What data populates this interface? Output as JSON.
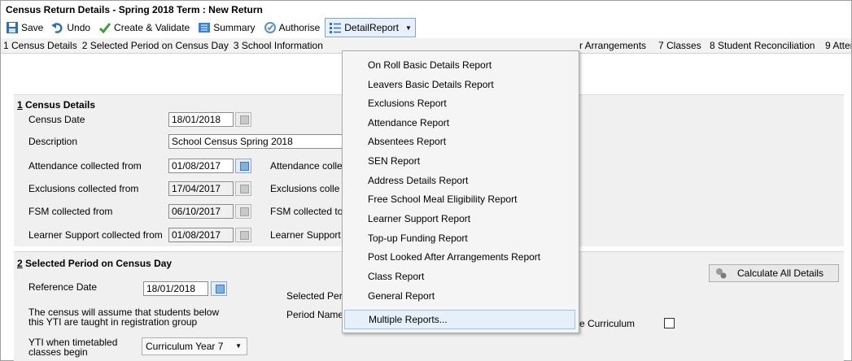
{
  "window": {
    "title": "Census Return Details - Spring 2018 Term : New Return"
  },
  "toolbar": {
    "save": "Save",
    "undo": "Undo",
    "create_validate": "Create & Validate",
    "summary": "Summary",
    "authorise": "Authorise",
    "detail_report": "DetailReport"
  },
  "tabs": {
    "t1": "1 Census Details",
    "t2": "2 Selected Period on Census Day",
    "t3": "3 School Information",
    "t_arr": "r Arrangements",
    "t7": "7 Classes",
    "t8": "8 Student Reconciliation",
    "t9": "9 Atter"
  },
  "section1": {
    "heading_num": "1",
    "heading_text": " Census Details",
    "census_date_label": "Census Date",
    "census_date_value": "18/01/2018",
    "description_label": "Description",
    "description_value": "School Census Spring 2018",
    "attendance_from_label": "Attendance collected from",
    "attendance_from_value": "01/08/2017",
    "attendance_to_label": "Attendance colle",
    "exclusions_from_label": "Exclusions collected from",
    "exclusions_from_value": "17/04/2017",
    "exclusions_to_label": "Exclusions colle",
    "fsm_from_label": "FSM collected from",
    "fsm_from_value": "06/10/2017",
    "fsm_to_label": "FSM collected to",
    "learner_from_label": "Learner Support collected from",
    "learner_from_value": "01/08/2017",
    "learner_to_label": "Learner Support"
  },
  "section2": {
    "heading_num": "2",
    "heading_text": " Selected Period on Census Day",
    "reference_date_label": "Reference Date",
    "reference_date_value": "18/01/2018",
    "selected_period_label": "Selected Per",
    "period_name_label": "Period Name",
    "yti_note_line1": "The census will assume that students below",
    "yti_note_line2": "this YTI are taught in registration group",
    "yti_label_line1": "YTI when timetabled",
    "yti_label_line2": "classes begin",
    "yti_value": "Curriculum Year 7",
    "curriculum_label": "e Curriculum",
    "calculate_button": "Calculate All Details"
  },
  "menu": {
    "items": [
      "On Roll Basic Details Report",
      "Leavers Basic Details Report",
      "Exclusions Report",
      "Attendance Report",
      "Absentees Report",
      "SEN Report",
      "Address Details Report",
      "Free School Meal Eligibility Report",
      "Learner Support Report",
      "Top-up Funding Report",
      "Post Looked After Arrangements Report",
      "Class Report",
      "General Report",
      "Multiple Reports..."
    ],
    "highlighted_index": 13
  },
  "colors": {
    "accent": "#3e7cc0",
    "highlight_bg": "#e5f0fb",
    "highlight_border": "#9cc3ea",
    "panel_bg": "#f0f0f0"
  }
}
